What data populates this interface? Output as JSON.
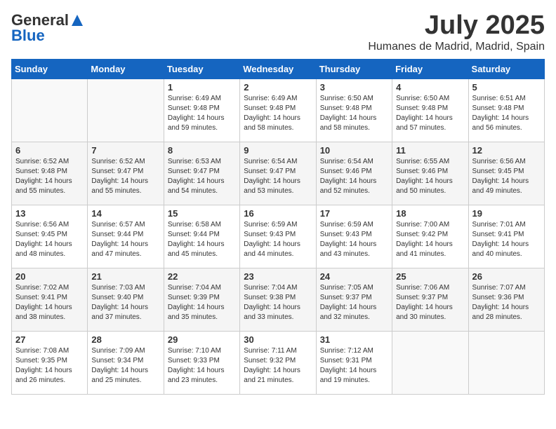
{
  "header": {
    "logo_general": "General",
    "logo_blue": "Blue",
    "month": "July 2025",
    "location": "Humanes de Madrid, Madrid, Spain"
  },
  "weekdays": [
    "Sunday",
    "Monday",
    "Tuesday",
    "Wednesday",
    "Thursday",
    "Friday",
    "Saturday"
  ],
  "weeks": [
    [
      {
        "day": "",
        "sunrise": "",
        "sunset": "",
        "daylight": ""
      },
      {
        "day": "",
        "sunrise": "",
        "sunset": "",
        "daylight": ""
      },
      {
        "day": "1",
        "sunrise": "Sunrise: 6:49 AM",
        "sunset": "Sunset: 9:48 PM",
        "daylight": "Daylight: 14 hours and 59 minutes."
      },
      {
        "day": "2",
        "sunrise": "Sunrise: 6:49 AM",
        "sunset": "Sunset: 9:48 PM",
        "daylight": "Daylight: 14 hours and 58 minutes."
      },
      {
        "day": "3",
        "sunrise": "Sunrise: 6:50 AM",
        "sunset": "Sunset: 9:48 PM",
        "daylight": "Daylight: 14 hours and 58 minutes."
      },
      {
        "day": "4",
        "sunrise": "Sunrise: 6:50 AM",
        "sunset": "Sunset: 9:48 PM",
        "daylight": "Daylight: 14 hours and 57 minutes."
      },
      {
        "day": "5",
        "sunrise": "Sunrise: 6:51 AM",
        "sunset": "Sunset: 9:48 PM",
        "daylight": "Daylight: 14 hours and 56 minutes."
      }
    ],
    [
      {
        "day": "6",
        "sunrise": "Sunrise: 6:52 AM",
        "sunset": "Sunset: 9:48 PM",
        "daylight": "Daylight: 14 hours and 55 minutes."
      },
      {
        "day": "7",
        "sunrise": "Sunrise: 6:52 AM",
        "sunset": "Sunset: 9:47 PM",
        "daylight": "Daylight: 14 hours and 55 minutes."
      },
      {
        "day": "8",
        "sunrise": "Sunrise: 6:53 AM",
        "sunset": "Sunset: 9:47 PM",
        "daylight": "Daylight: 14 hours and 54 minutes."
      },
      {
        "day": "9",
        "sunrise": "Sunrise: 6:54 AM",
        "sunset": "Sunset: 9:47 PM",
        "daylight": "Daylight: 14 hours and 53 minutes."
      },
      {
        "day": "10",
        "sunrise": "Sunrise: 6:54 AM",
        "sunset": "Sunset: 9:46 PM",
        "daylight": "Daylight: 14 hours and 52 minutes."
      },
      {
        "day": "11",
        "sunrise": "Sunrise: 6:55 AM",
        "sunset": "Sunset: 9:46 PM",
        "daylight": "Daylight: 14 hours and 50 minutes."
      },
      {
        "day": "12",
        "sunrise": "Sunrise: 6:56 AM",
        "sunset": "Sunset: 9:45 PM",
        "daylight": "Daylight: 14 hours and 49 minutes."
      }
    ],
    [
      {
        "day": "13",
        "sunrise": "Sunrise: 6:56 AM",
        "sunset": "Sunset: 9:45 PM",
        "daylight": "Daylight: 14 hours and 48 minutes."
      },
      {
        "day": "14",
        "sunrise": "Sunrise: 6:57 AM",
        "sunset": "Sunset: 9:44 PM",
        "daylight": "Daylight: 14 hours and 47 minutes."
      },
      {
        "day": "15",
        "sunrise": "Sunrise: 6:58 AM",
        "sunset": "Sunset: 9:44 PM",
        "daylight": "Daylight: 14 hours and 45 minutes."
      },
      {
        "day": "16",
        "sunrise": "Sunrise: 6:59 AM",
        "sunset": "Sunset: 9:43 PM",
        "daylight": "Daylight: 14 hours and 44 minutes."
      },
      {
        "day": "17",
        "sunrise": "Sunrise: 6:59 AM",
        "sunset": "Sunset: 9:43 PM",
        "daylight": "Daylight: 14 hours and 43 minutes."
      },
      {
        "day": "18",
        "sunrise": "Sunrise: 7:00 AM",
        "sunset": "Sunset: 9:42 PM",
        "daylight": "Daylight: 14 hours and 41 minutes."
      },
      {
        "day": "19",
        "sunrise": "Sunrise: 7:01 AM",
        "sunset": "Sunset: 9:41 PM",
        "daylight": "Daylight: 14 hours and 40 minutes."
      }
    ],
    [
      {
        "day": "20",
        "sunrise": "Sunrise: 7:02 AM",
        "sunset": "Sunset: 9:41 PM",
        "daylight": "Daylight: 14 hours and 38 minutes."
      },
      {
        "day": "21",
        "sunrise": "Sunrise: 7:03 AM",
        "sunset": "Sunset: 9:40 PM",
        "daylight": "Daylight: 14 hours and 37 minutes."
      },
      {
        "day": "22",
        "sunrise": "Sunrise: 7:04 AM",
        "sunset": "Sunset: 9:39 PM",
        "daylight": "Daylight: 14 hours and 35 minutes."
      },
      {
        "day": "23",
        "sunrise": "Sunrise: 7:04 AM",
        "sunset": "Sunset: 9:38 PM",
        "daylight": "Daylight: 14 hours and 33 minutes."
      },
      {
        "day": "24",
        "sunrise": "Sunrise: 7:05 AM",
        "sunset": "Sunset: 9:37 PM",
        "daylight": "Daylight: 14 hours and 32 minutes."
      },
      {
        "day": "25",
        "sunrise": "Sunrise: 7:06 AM",
        "sunset": "Sunset: 9:37 PM",
        "daylight": "Daylight: 14 hours and 30 minutes."
      },
      {
        "day": "26",
        "sunrise": "Sunrise: 7:07 AM",
        "sunset": "Sunset: 9:36 PM",
        "daylight": "Daylight: 14 hours and 28 minutes."
      }
    ],
    [
      {
        "day": "27",
        "sunrise": "Sunrise: 7:08 AM",
        "sunset": "Sunset: 9:35 PM",
        "daylight": "Daylight: 14 hours and 26 minutes."
      },
      {
        "day": "28",
        "sunrise": "Sunrise: 7:09 AM",
        "sunset": "Sunset: 9:34 PM",
        "daylight": "Daylight: 14 hours and 25 minutes."
      },
      {
        "day": "29",
        "sunrise": "Sunrise: 7:10 AM",
        "sunset": "Sunset: 9:33 PM",
        "daylight": "Daylight: 14 hours and 23 minutes."
      },
      {
        "day": "30",
        "sunrise": "Sunrise: 7:11 AM",
        "sunset": "Sunset: 9:32 PM",
        "daylight": "Daylight: 14 hours and 21 minutes."
      },
      {
        "day": "31",
        "sunrise": "Sunrise: 7:12 AM",
        "sunset": "Sunset: 9:31 PM",
        "daylight": "Daylight: 14 hours and 19 minutes."
      },
      {
        "day": "",
        "sunrise": "",
        "sunset": "",
        "daylight": ""
      },
      {
        "day": "",
        "sunrise": "",
        "sunset": "",
        "daylight": ""
      }
    ]
  ]
}
